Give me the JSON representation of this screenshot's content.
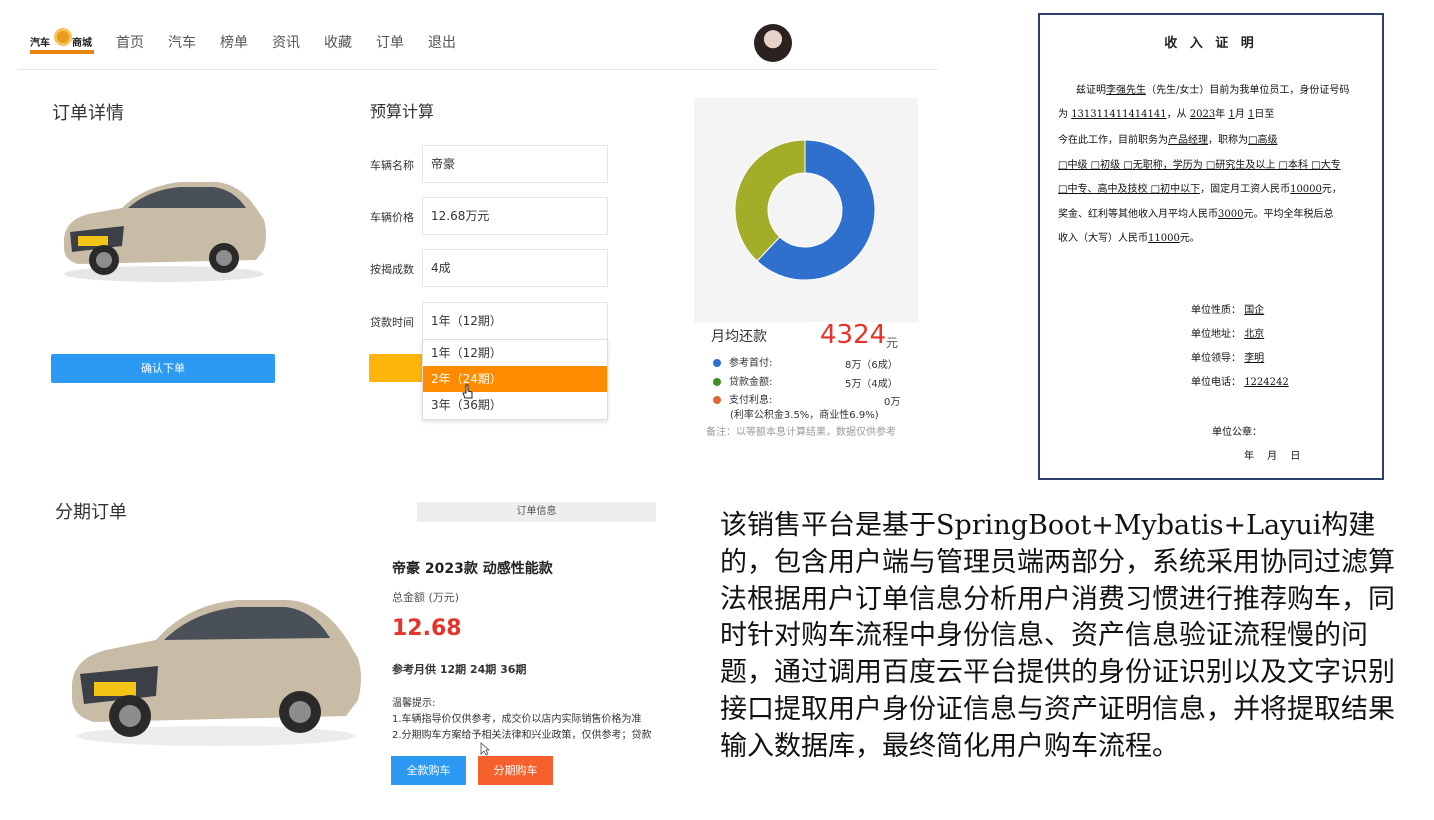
{
  "nav": {
    "logo_left": "汽车",
    "logo_right": "商城",
    "items": [
      "首页",
      "汽车",
      "榜单",
      "资讯",
      "收藏",
      "订单",
      "退出"
    ]
  },
  "order_detail": {
    "title": "订单详情",
    "confirm_button": "确认下单"
  },
  "budget": {
    "title": "预算计算",
    "fields": [
      {
        "label": "车辆名称",
        "value": "帝豪"
      },
      {
        "label": "车辆价格",
        "value": "12.68万元"
      },
      {
        "label": "按揭成数",
        "value": "4成"
      },
      {
        "label": "贷款时间",
        "value": "1年（12期）"
      }
    ],
    "dropdown_options": [
      "1年（12期）",
      "2年（24期）",
      "3年（36期）"
    ],
    "dropdown_selected_index": 1
  },
  "repayment": {
    "label": "月均还款",
    "value": "4324",
    "unit": "元",
    "legend": [
      {
        "name": "参考首付:",
        "value": "8万（6成）",
        "color": "#2f6fce"
      },
      {
        "name": "贷款金额:",
        "value": "5万（4成）",
        "color": "#a3ad2a"
      },
      {
        "name": "支付利息:",
        "value": "0万",
        "color": "#e0663a"
      }
    ],
    "rate_note": "(利率公积金3.5%，商业性6.9%)",
    "footnote": "备注：以等额本息计算结果，数据仅供参考",
    "donut_share": [
      0.62,
      0.38
    ],
    "donut_colors": [
      "#2f6fce",
      "#a3ad2a"
    ]
  },
  "certificate": {
    "title": "收 入 证 明",
    "line1_a": "兹证明",
    "line1_name": "李强先生",
    "line1_b": "（先生/女士）目前为我单位员工，身份证号码",
    "line2_a": "为",
    "line2_id": "131311411414141",
    "line2_b": "，从",
    "line2_year": "2023",
    "line2_c": "年",
    "line2_month": "1",
    "line2_d": "月",
    "line2_day": "1",
    "line2_e": "日至",
    "line3_a": "今在此工作，目前职务为",
    "line3_job": "产品经理",
    "line3_b": "，职称为",
    "line3_c": "□高级",
    "line4": "□中级 □初级 □无职称，学历为 □研究生及以上 □本科 □大专",
    "line5_a": "□中专、高中及技校 □初中以下",
    "line5_b": "，固定月工资人民币",
    "line5_salary": "10000",
    "line5_c": "元，",
    "line6_a": "奖金、红利等其他收入月平均人民币",
    "line6_bonus": "3000",
    "line6_b": "元。平均全年税后总",
    "line7_a": "收入（大写）人民币",
    "line7_total": "11000",
    "line7_b": "元。",
    "unit_rows": [
      {
        "label": "单位性质：",
        "value": "国企"
      },
      {
        "label": "单位地址：",
        "value": "北京"
      },
      {
        "label": "单位领导：",
        "value": "李明"
      },
      {
        "label": "单位电话：",
        "value": "1224242"
      }
    ],
    "seal_label": "单位公章：",
    "date_line": "年 月 日"
  },
  "installment": {
    "title": "分期订单",
    "info_bar": "订单信息",
    "model": "帝豪 2023款 动感性能款",
    "total_label": "总金额 (万元)",
    "total_value": "12.68",
    "monthly_ref": "参考月供 12期 24期 36期",
    "tips_title": "温馨提示:",
    "tip1": "1.车辆指导价仅供参考，成交价以店内实际销售价格为准",
    "tip2": "2.分期购车方案给予相关法律和兴业政策，仅供参考；贷款",
    "btn_full": "全款购车",
    "btn_installment": "分期购车"
  },
  "description": "该销售平台是基于SpringBoot+Mybatis+Layui构建的，包含用户端与管理员端两部分，系统采用协同过滤算法根据用户订单信息分析用户消费习惯进行推荐购车，同时针对购车流程中身份信息、资产信息验证流程慢的问题，通过调用百度云平台提供的身份证识别以及文字识别接口提取用户身份证信息与资产证明信息，并将提取结果输入数据库，最终简化用户购车流程。"
}
